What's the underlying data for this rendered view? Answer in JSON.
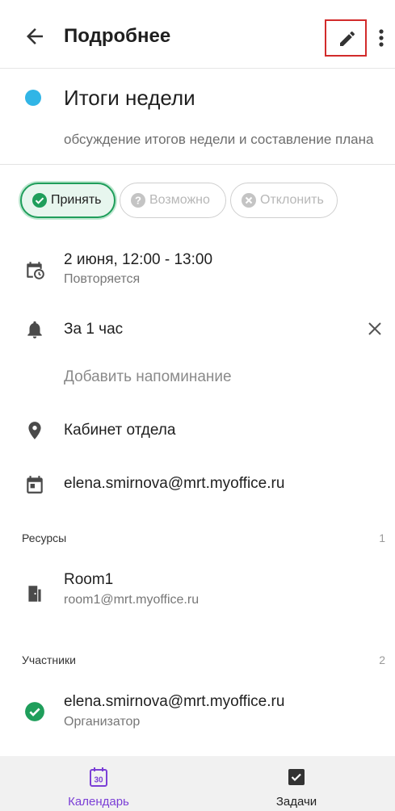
{
  "appbar": {
    "title": "Подробнее",
    "back_icon": "arrow-left-icon",
    "edit_icon": "pencil-icon",
    "more_icon": "more-vertical-icon"
  },
  "event": {
    "title": "Итоги недели",
    "description": "обсуждение итогов недели и составление плана",
    "color": "#31b5e6"
  },
  "rsvp": {
    "accept_label": "Принять",
    "maybe_label": "Возможно",
    "decline_label": "Отклонить",
    "accept_color": "#1f9e5b",
    "selected": "accept"
  },
  "time": {
    "main": "2 июня, 12:00 - 13:00",
    "sub": "Повторяется"
  },
  "reminder": {
    "main": "За 1 час",
    "add_label": "Добавить напоминание"
  },
  "location": {
    "main": "Кабинет отдела"
  },
  "calendar": {
    "main": "elena.smirnova@mrt.myoffice.ru"
  },
  "resources": {
    "label": "Ресурсы",
    "count": "1",
    "items": [
      {
        "name": "Room1",
        "email": "room1@mrt.myoffice.ru"
      }
    ]
  },
  "participants": {
    "label": "Участники",
    "count": "2",
    "items": [
      {
        "name": "elena.smirnova@mrt.myoffice.ru",
        "role": "Организатор",
        "status_color": "#1f9e5b"
      }
    ]
  },
  "bottom_nav": {
    "calendar_label": "Календарь",
    "calendar_day": "30",
    "tasks_label": "Задачи",
    "active_color": "#7b3fd6"
  }
}
